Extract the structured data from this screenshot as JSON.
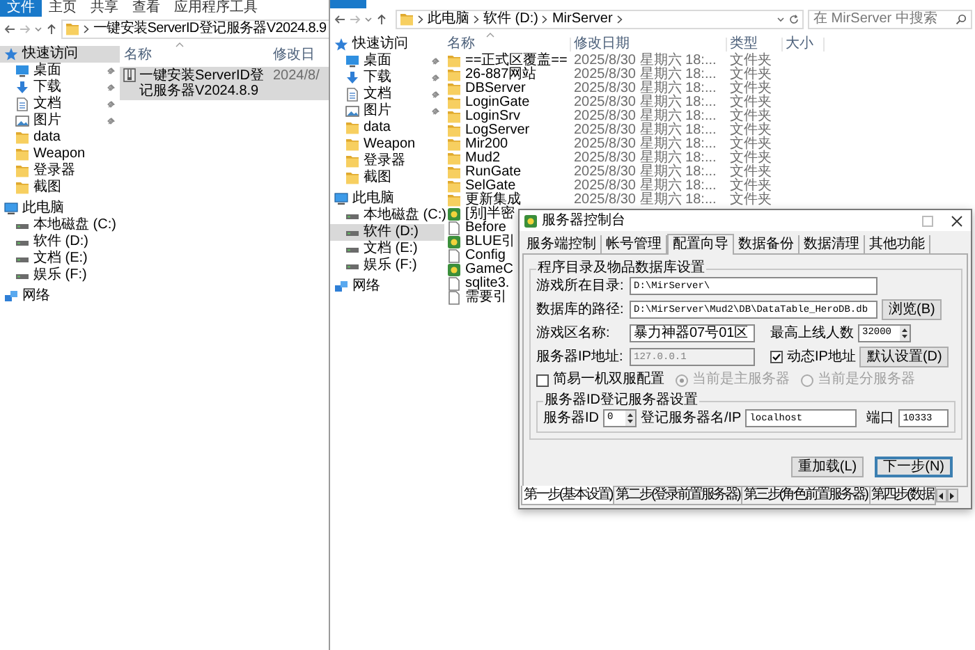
{
  "left_window": {
    "ribbon_tabs": [
      {
        "label": "文件",
        "selected": true
      },
      {
        "label": "主页",
        "selected": false
      },
      {
        "label": "共享",
        "selected": false
      },
      {
        "label": "查看",
        "selected": false
      },
      {
        "label": "应用程序工具",
        "selected": false
      }
    ],
    "path": [
      "一键安装ServerID登记服务器V2024.8.9"
    ],
    "sidebar": [
      {
        "label": "快速访问",
        "kind": "star",
        "selected": true,
        "children": [
          {
            "label": "桌面",
            "kind": "desktop",
            "pinned": true,
            "selected": false
          },
          {
            "label": "下载",
            "kind": "download",
            "pinned": true,
            "selected": false
          },
          {
            "label": "文档",
            "kind": "document",
            "pinned": true,
            "selected": false
          },
          {
            "label": "图片",
            "kind": "picture",
            "pinned": true,
            "selected": false
          },
          {
            "label": "data",
            "kind": "folder",
            "pinned": false,
            "selected": false
          },
          {
            "label": "Weapon",
            "kind": "folder",
            "pinned": false,
            "selected": false
          },
          {
            "label": "登录器",
            "kind": "folder",
            "pinned": false,
            "selected": false
          },
          {
            "label": "截图",
            "kind": "folder",
            "pinned": false,
            "selected": false
          }
        ]
      },
      {
        "label": "此电脑",
        "kind": "pc",
        "selected": false,
        "children": [
          {
            "label": "本地磁盘 (C:)",
            "kind": "drive",
            "selected": false
          },
          {
            "label": "软件 (D:)",
            "kind": "drive",
            "selected": false
          },
          {
            "label": "文档 (E:)",
            "kind": "drive",
            "selected": false
          },
          {
            "label": "娱乐 (F:)",
            "kind": "drive",
            "selected": false
          }
        ]
      },
      {
        "label": "网络",
        "kind": "network",
        "selected": false
      }
    ],
    "columns": [
      "名称",
      "修改日"
    ],
    "rows": [
      {
        "name": "一键安装ServerID登记服务器V2024.8.9",
        "modified": "2024/8/",
        "kind": "archive",
        "selected": true
      }
    ]
  },
  "right_window": {
    "path": [
      "此电脑",
      "软件 (D:)",
      "MirServer"
    ],
    "search": {
      "placeholder": "在 MirServer 中搜索"
    },
    "sidebar": [
      {
        "label": "快速访问",
        "kind": "star",
        "selected": false,
        "children": [
          {
            "label": "桌面",
            "kind": "desktop",
            "pinned": true,
            "selected": false
          },
          {
            "label": "下载",
            "kind": "download",
            "pinned": true,
            "selected": false
          },
          {
            "label": "文档",
            "kind": "document",
            "pinned": true,
            "selected": false
          },
          {
            "label": "图片",
            "kind": "picture",
            "pinned": true,
            "selected": false
          },
          {
            "label": "data",
            "kind": "folder",
            "pinned": false,
            "selected": false
          },
          {
            "label": "Weapon",
            "kind": "folder",
            "pinned": false,
            "selected": false
          },
          {
            "label": "登录器",
            "kind": "folder",
            "pinned": false,
            "selected": false
          },
          {
            "label": "截图",
            "kind": "folder",
            "pinned": false,
            "selected": false
          }
        ]
      },
      {
        "label": "此电脑",
        "kind": "pc",
        "selected": false,
        "children": [
          {
            "label": "本地磁盘 (C:)",
            "kind": "drive",
            "selected": false
          },
          {
            "label": "软件 (D:)",
            "kind": "drive",
            "selected": true
          },
          {
            "label": "文档 (E:)",
            "kind": "drive",
            "selected": false
          },
          {
            "label": "娱乐 (F:)",
            "kind": "drive",
            "selected": false
          }
        ]
      },
      {
        "label": "网络",
        "kind": "network",
        "selected": false
      }
    ],
    "columns": [
      "名称",
      "修改日期",
      "类型",
      "大小"
    ],
    "rows": [
      {
        "name": "==正式区覆盖==",
        "modified": "2025/8/30 星期六 18:...",
        "type": "文件夹",
        "kind": "folder"
      },
      {
        "name": "26-887网站",
        "modified": "2025/8/30 星期六 18:...",
        "type": "文件夹",
        "kind": "folder"
      },
      {
        "name": "DBServer",
        "modified": "2025/8/30 星期六 18:...",
        "type": "文件夹",
        "kind": "folder"
      },
      {
        "name": "LoginGate",
        "modified": "2025/8/30 星期六 18:...",
        "type": "文件夹",
        "kind": "folder"
      },
      {
        "name": "LoginSrv",
        "modified": "2025/8/30 星期六 18:...",
        "type": "文件夹",
        "kind": "folder"
      },
      {
        "name": "LogServer",
        "modified": "2025/8/30 星期六 18:...",
        "type": "文件夹",
        "kind": "folder"
      },
      {
        "name": "Mir200",
        "modified": "2025/8/30 星期六 18:...",
        "type": "文件夹",
        "kind": "folder"
      },
      {
        "name": "Mud2",
        "modified": "2025/8/30 星期六 18:...",
        "type": "文件夹",
        "kind": "folder"
      },
      {
        "name": "RunGate",
        "modified": "2025/8/30 星期六 18:...",
        "type": "文件夹",
        "kind": "folder"
      },
      {
        "name": "SelGate",
        "modified": "2025/8/30 星期六 18:...",
        "type": "文件夹",
        "kind": "folder"
      },
      {
        "name": "更新集成",
        "modified": "2025/8/30 星期六 18:...",
        "type": "文件夹",
        "kind": "folder"
      },
      {
        "name": "[别]半密",
        "kind": "app"
      },
      {
        "name": "Before",
        "kind": "file"
      },
      {
        "name": "BLUE引",
        "kind": "app"
      },
      {
        "name": "Config",
        "kind": "file"
      },
      {
        "name": "GameC",
        "kind": "app"
      },
      {
        "name": "sqlite3.",
        "kind": "file"
      },
      {
        "name": "需要引",
        "kind": "file"
      }
    ]
  },
  "dialog": {
    "title": "服务器控制台",
    "tabs": [
      {
        "label": "服务端控制",
        "selected": false
      },
      {
        "label": "帐号管理",
        "selected": false
      },
      {
        "label": "配置向导",
        "selected": true
      },
      {
        "label": "数据备份",
        "selected": false
      },
      {
        "label": "数据清理",
        "selected": false
      },
      {
        "label": "其他功能",
        "selected": false
      }
    ],
    "settings": {
      "title": "程序目录及物品数据库设置",
      "game_dir": {
        "label": "游戏所在目录:",
        "value": "D:\\MirServer\\"
      },
      "db_path": {
        "label": "数据库的路径:",
        "value": "D:\\MirServer\\Mud2\\DB\\DataTable_HeroDB.db",
        "button": "浏览(B)"
      },
      "zone_name": {
        "label": "游戏区名称:",
        "value": "暴力神器07号01区"
      },
      "max_online": {
        "label": "最高上线人数",
        "value": "32000"
      },
      "server_ip": {
        "label": "服务器IP地址:",
        "value": "127.0.0.1",
        "disabled": true
      },
      "dynamic_ip": {
        "label": "动态IP地址",
        "checked": true
      },
      "defaults_button": "默认设置(D)",
      "dual_server": {
        "label": "简易一机双服配置",
        "checked": false
      },
      "server_role": [
        {
          "label": "当前是主服务器",
          "selected": true,
          "disabled": true
        },
        {
          "label": "当前是分服务器",
          "selected": false,
          "disabled": true
        }
      ]
    },
    "registry": {
      "title": "服务器ID登记服务器设置",
      "server_id": {
        "label": "服务器ID",
        "value": "0"
      },
      "host": {
        "label": "登记服务器名/IP",
        "value": "localhost"
      },
      "port": {
        "label": "端口",
        "value": "10333"
      }
    },
    "buttons": [
      {
        "label": "重加载(L)",
        "default": false
      },
      {
        "label": "下一步(N)",
        "default": true
      }
    ],
    "steps": [
      {
        "label": "第一步(基本设置)",
        "selected": true
      },
      {
        "label": "第二步(登录前置服务器)",
        "selected": false
      },
      {
        "label": "第三步(角色前置服务器)",
        "selected": false
      },
      {
        "label": "第四步(数据",
        "selected": false
      }
    ]
  }
}
